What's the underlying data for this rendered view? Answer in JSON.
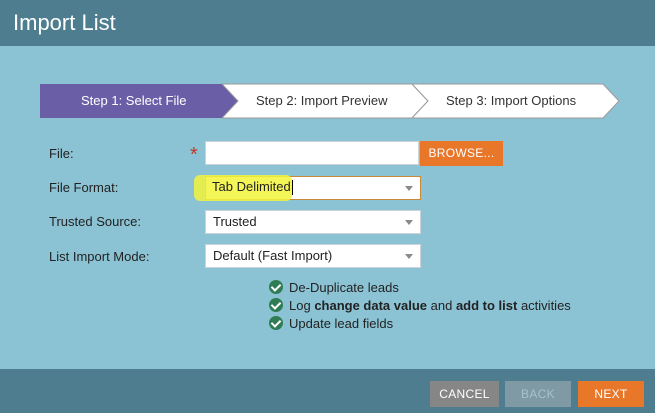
{
  "window": {
    "title": "Import List"
  },
  "steps": [
    {
      "label": "Step 1: Select File",
      "active": true
    },
    {
      "label": "Step 2: Import Preview",
      "active": false
    },
    {
      "label": "Step 3: Import Options",
      "active": false
    }
  ],
  "form": {
    "file": {
      "label": "File:",
      "value": "",
      "required_mark": "*",
      "browse_label": "BROWSE..."
    },
    "file_format": {
      "label": "File Format:",
      "value": "Tab Delimited"
    },
    "trusted_source": {
      "label": "Trusted Source:",
      "value": "Trusted"
    },
    "list_import_mode": {
      "label": "List Import Mode:",
      "value": "Default (Fast Import)"
    }
  },
  "options": [
    {
      "icon": "check-circle-icon",
      "parts": [
        "De-Duplicate leads"
      ]
    },
    {
      "icon": "check-circle-icon",
      "parts": [
        "Log ",
        "change data value",
        " and ",
        "add to list",
        " activities"
      ]
    },
    {
      "icon": "check-circle-icon",
      "parts": [
        "Update lead fields"
      ]
    }
  ],
  "footer": {
    "cancel": "CANCEL",
    "back": "BACK",
    "next": "NEXT"
  },
  "colors": {
    "header": "#4e7d8f",
    "background": "#8bc3d4",
    "active_step": "#6a5fa6",
    "accent_orange": "#e8772a",
    "check_green": "#2f7d55",
    "highlight": "#f2f53a"
  }
}
